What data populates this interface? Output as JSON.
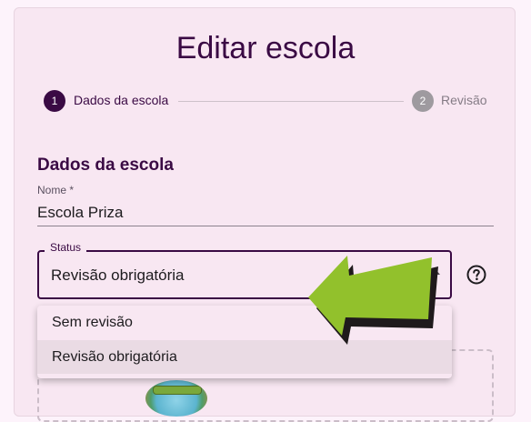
{
  "page": {
    "title": "Editar escola"
  },
  "stepper": {
    "steps": [
      {
        "number": "1",
        "label": "Dados da escola",
        "active": true
      },
      {
        "number": "2",
        "label": "Revisão",
        "active": false
      }
    ]
  },
  "form": {
    "section_title": "Dados da escola",
    "name": {
      "label": "Nome *",
      "value": "Escola Priza"
    },
    "status": {
      "label": "Status",
      "value": "Revisão obrigatória",
      "options": [
        "Sem revisão",
        "Revisão obrigatória"
      ]
    },
    "help_icon": "help-circle-icon"
  },
  "annotation": {
    "icon": "green-arrow-pointer",
    "color": "#92c12c"
  },
  "colors": {
    "primary": "#3a0a44",
    "card": "#f8e7f2",
    "inactive_step": "#9e9a9f"
  }
}
